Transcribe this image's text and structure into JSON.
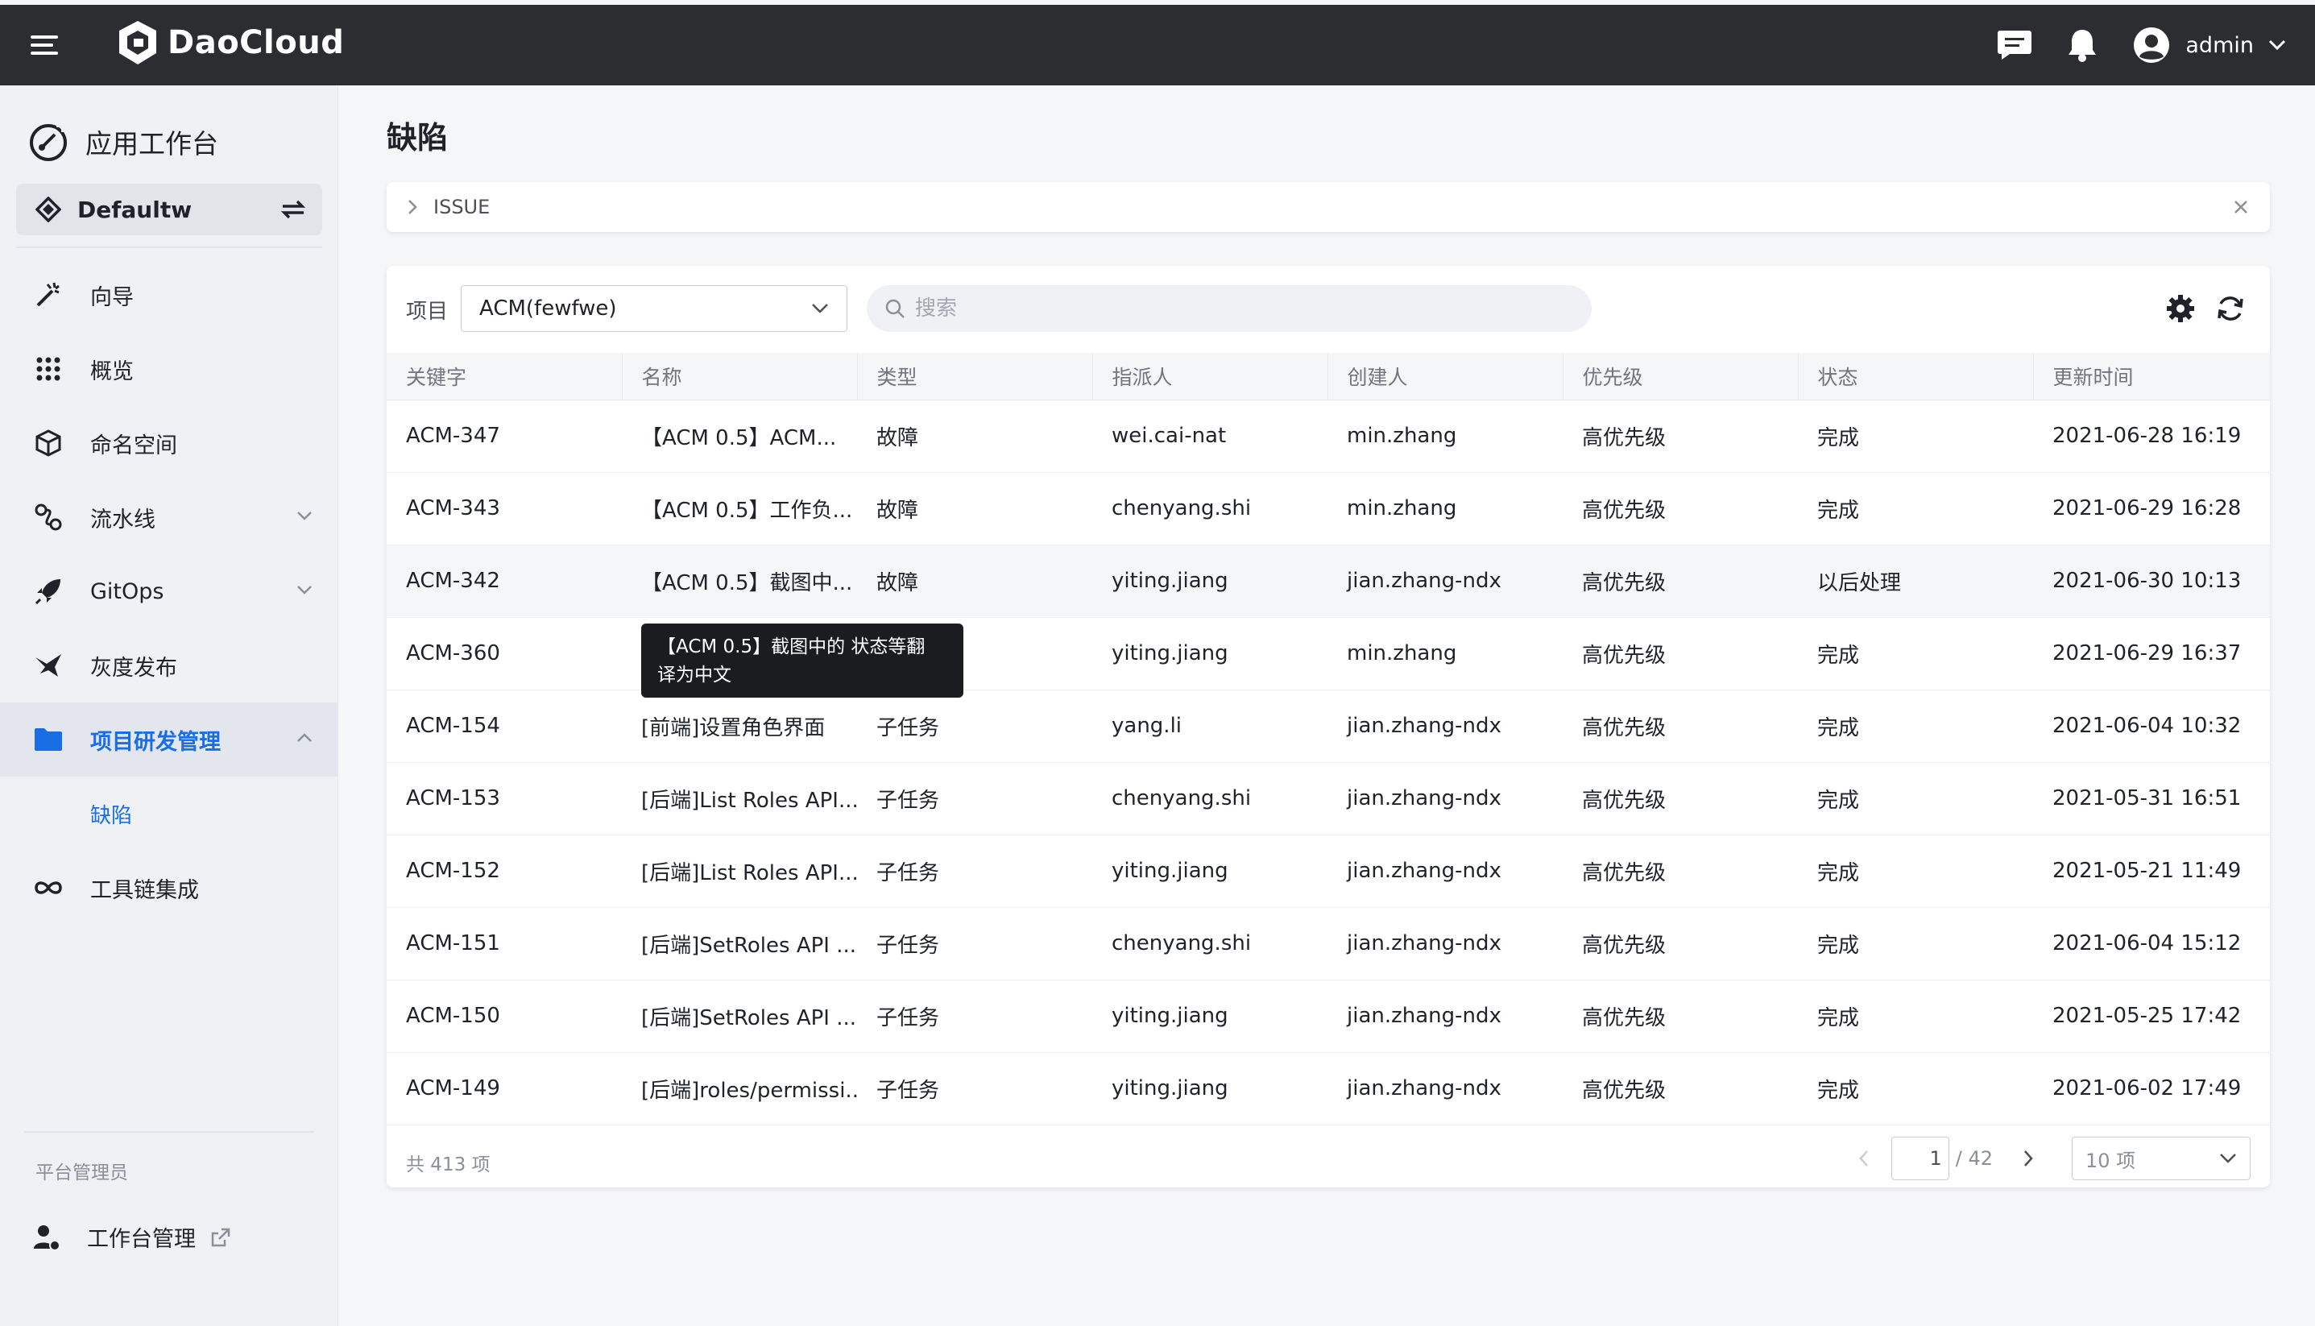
{
  "topbar": {
    "logo_text": "DaoCloud",
    "user_name": "admin"
  },
  "sidebar": {
    "title": "应用工作台",
    "workspace": "Defaultw",
    "items": [
      {
        "label": "向导"
      },
      {
        "label": "概览"
      },
      {
        "label": "命名空间"
      },
      {
        "label": "流水线"
      },
      {
        "label": "GitOps"
      },
      {
        "label": "灰度发布"
      },
      {
        "label": "项目研发管理"
      },
      {
        "label": "缺陷"
      },
      {
        "label": "工具链集成"
      }
    ],
    "section_label": "平台管理员",
    "admin_link": "工作台管理"
  },
  "page": {
    "title": "缺陷",
    "breadcrumb": "ISSUE"
  },
  "toolbar": {
    "project_label": "项目",
    "project_value": "ACM(fewfwe)",
    "search_placeholder": "搜索"
  },
  "table": {
    "columns": [
      "关键字",
      "名称",
      "类型",
      "指派人",
      "创建人",
      "优先级",
      "状态",
      "更新时间"
    ],
    "rows": [
      [
        "ACM-347",
        "【ACM 0.5】ACM...",
        "故障",
        "wei.cai-nat",
        "min.zhang",
        "高优先级",
        "完成",
        "2021-06-28 16:19"
      ],
      [
        "ACM-343",
        "【ACM 0.5】工作负...",
        "故障",
        "chenyang.shi",
        "min.zhang",
        "高优先级",
        "完成",
        "2021-06-29 16:28"
      ],
      [
        "ACM-342",
        "【ACM 0.5】截图中...",
        "故障",
        "yiting.jiang",
        "jian.zhang-ndx",
        "高优先级",
        "以后处理",
        "2021-06-30 10:13"
      ],
      [
        "ACM-360",
        "",
        "",
        "yiting.jiang",
        "min.zhang",
        "高优先级",
        "完成",
        "2021-06-29 16:37"
      ],
      [
        "ACM-154",
        "[前端]设置角色界面",
        "子任务",
        "yang.li",
        "jian.zhang-ndx",
        "高优先级",
        "完成",
        "2021-06-04 10:32"
      ],
      [
        "ACM-153",
        "[后端]List Roles API...",
        "子任务",
        "chenyang.shi",
        "jian.zhang-ndx",
        "高优先级",
        "完成",
        "2021-05-31 16:51"
      ],
      [
        "ACM-152",
        "[后端]List Roles API...",
        "子任务",
        "yiting.jiang",
        "jian.zhang-ndx",
        "高优先级",
        "完成",
        "2021-05-21 11:49"
      ],
      [
        "ACM-151",
        "[后端]SetRoles API ...",
        "子任务",
        "chenyang.shi",
        "jian.zhang-ndx",
        "高优先级",
        "完成",
        "2021-06-04 15:12"
      ],
      [
        "ACM-150",
        "[后端]SetRoles API ...",
        "子任务",
        "yiting.jiang",
        "jian.zhang-ndx",
        "高优先级",
        "完成",
        "2021-05-25 17:42"
      ],
      [
        "ACM-149",
        "[后端]roles/permissi...",
        "子任务",
        "yiting.jiang",
        "jian.zhang-ndx",
        "高优先级",
        "完成",
        "2021-06-02 17:49"
      ]
    ],
    "hovered_row": 2
  },
  "tooltip": {
    "line1": "【ACM 0.5】截图中的 状态等翻",
    "line2": "译为中文"
  },
  "footer": {
    "total": "共 413 项",
    "current_page": "1",
    "total_pages": "/ 42",
    "page_size": "10 项"
  },
  "colors": {
    "topbar": "#2b2d31",
    "accent": "#1a6ee5",
    "sidebar_bg": "#f0f1f4"
  }
}
